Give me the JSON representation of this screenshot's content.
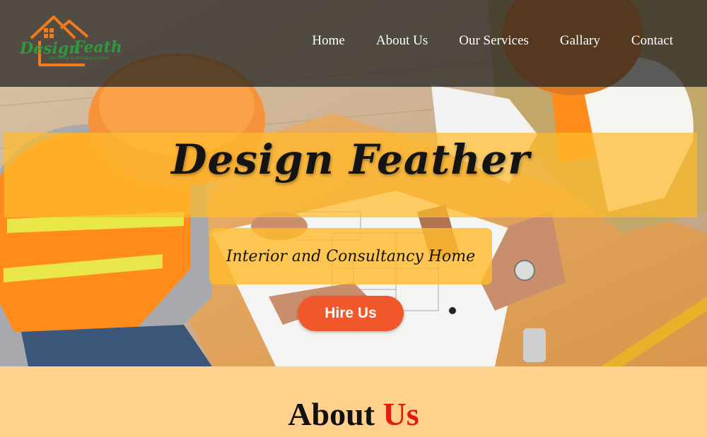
{
  "brand": {
    "logo_text": "Design Feather",
    "logo_tagline": "the interior & consultancy home",
    "logo_color": "#2e9a3e",
    "logo_roof_color": "#f07a1c"
  },
  "nav": {
    "items": [
      {
        "label": "Home"
      },
      {
        "label": "About Us"
      },
      {
        "label": "Our Services"
      },
      {
        "label": "Gallary"
      },
      {
        "label": "Contact"
      }
    ]
  },
  "hero": {
    "title": "Design Feather",
    "subtitle": "Interior and Consultancy Home",
    "cta_label": "Hire Us",
    "cta_color": "#f0572a",
    "band_color": "#ffbb2d"
  },
  "about": {
    "heading_main": "About",
    "heading_accent": "Us",
    "accent_color": "#e31b0e",
    "background": "#ffd18c"
  }
}
